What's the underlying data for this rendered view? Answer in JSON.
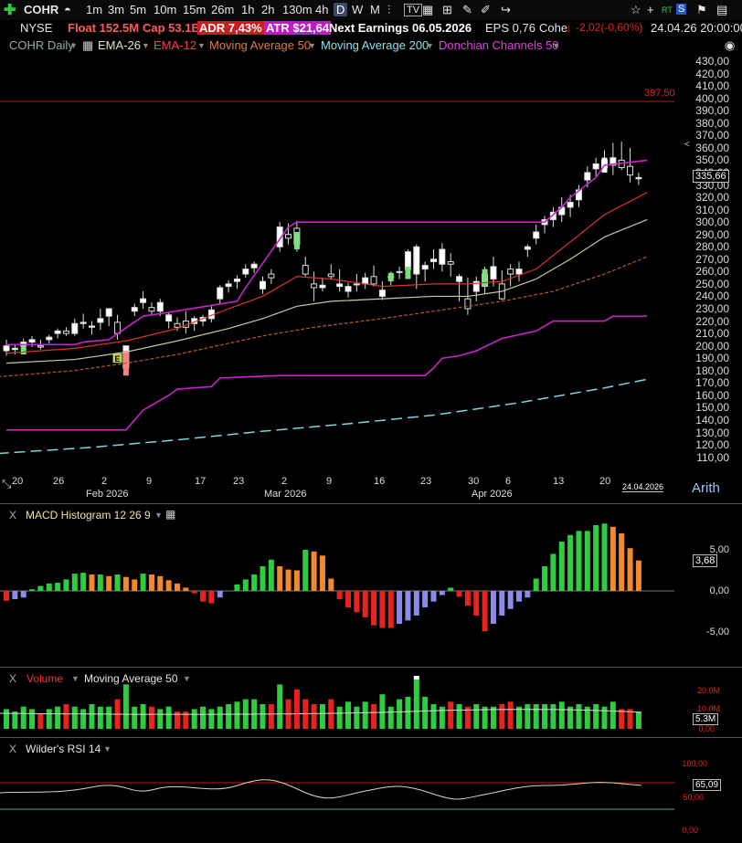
{
  "toolbar": {
    "ticker": "COHR",
    "timeframes": [
      "1m",
      "3m",
      "5m",
      "10m",
      "15m",
      "26m",
      "1h",
      "2h",
      "130m",
      "4h",
      "D",
      "W",
      "M"
    ],
    "active_timeframe": "D",
    "price": "335,66"
  },
  "header2": {
    "exchange": "NYSE",
    "float": "Float 152.5M",
    "cap": "Cap 53.1B",
    "adr": "ADR  7,43%",
    "atr": "ATR $21,64",
    "earnings": "Next Earnings 06.05.2026",
    "eps": "EPS 0,76",
    "name": "Cohe",
    "change": "-2,02(-0,60%)",
    "datetime": "24.04.26 20:00:00"
  },
  "indicators": {
    "symbol": "COHR Daily",
    "ema26": "EMA-26",
    "ema12": "EMA-12",
    "ma50": "Moving Average 50",
    "ma200": "Moving Average 200",
    "donchian": "Donchian Channels 50"
  },
  "main_chart": {
    "hline_label": "397,50",
    "current_price": "335,66",
    "y_labels": [
      "430,00",
      "420,00",
      "410,00",
      "400,00",
      "390,00",
      "380,00",
      "370,00",
      "360,00",
      "350,00",
      "340,00",
      "330,00",
      "320,00",
      "310,00",
      "300,00",
      "290,00",
      "280,00",
      "270,00",
      "260,00",
      "250,00",
      "240,00",
      "230,00",
      "220,00",
      "210,00",
      "200,00",
      "190,00",
      "180,00",
      "170,00",
      "160,00",
      "150,00",
      "140,00",
      "130,00",
      "120,00",
      "110,00"
    ],
    "x_days": [
      "20",
      "26",
      "2",
      "9",
      "17",
      "23",
      "2",
      "9",
      "16",
      "23",
      "30",
      "6",
      "13",
      "20"
    ],
    "x_months": [
      "Feb 2026",
      "Mar 2026",
      "Apr 2026"
    ],
    "date_tag": "24.04.2026",
    "scale_mode": "Arith",
    "earnings_marker": "E"
  },
  "macd": {
    "close": "X",
    "title": "MACD Histogram 12 26 9",
    "y_labels": [
      "5,00",
      "0,00",
      "-5,00"
    ],
    "current": "3,68"
  },
  "volume": {
    "close": "X",
    "title": "Volume",
    "ma_title": "Moving Average 50",
    "y_labels": [
      "20.0M",
      "10.0M",
      "0,00"
    ],
    "current": "5.3M"
  },
  "rsi": {
    "close": "X",
    "title": "Wilder's RSI 14",
    "y_labels": [
      "100,00",
      "50,00",
      "0,00"
    ],
    "current": "65,09"
  },
  "colors": {
    "up": "#2ecc40",
    "down": "#e8231e",
    "donchian": "#cc22cc",
    "ema12": "#e03030",
    "ema26": "#c9c9a0",
    "ma50": "#b05a2a",
    "ma200": "#7fd8e0"
  }
}
